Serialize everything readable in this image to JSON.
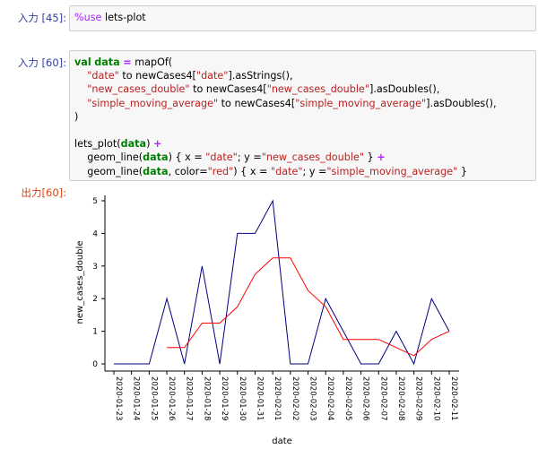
{
  "cells": [
    {
      "prompt": "入力 [45]:",
      "code": [
        [
          {
            "t": "%use",
            "c": "magic"
          },
          {
            "t": " lets-plot",
            "c": ""
          }
        ]
      ]
    },
    {
      "prompt": "入力 [60]:",
      "code": [
        [
          {
            "t": "val",
            "c": "kw"
          },
          {
            "t": " ",
            "c": ""
          },
          {
            "t": "data",
            "c": "kw"
          },
          {
            "t": " ",
            "c": ""
          },
          {
            "t": "=",
            "c": "op"
          },
          {
            "t": " mapOf(",
            "c": ""
          }
        ],
        [
          {
            "t": "    ",
            "c": ""
          },
          {
            "t": "\"date\"",
            "c": "str"
          },
          {
            "t": " to newCases4[",
            "c": ""
          },
          {
            "t": "\"date\"",
            "c": "str"
          },
          {
            "t": "].asStrings(),",
            "c": ""
          }
        ],
        [
          {
            "t": "    ",
            "c": ""
          },
          {
            "t": "\"new_cases_double\"",
            "c": "str"
          },
          {
            "t": " to newCases4[",
            "c": ""
          },
          {
            "t": "\"new_cases_double\"",
            "c": "str"
          },
          {
            "t": "].asDoubles(),",
            "c": ""
          }
        ],
        [
          {
            "t": "    ",
            "c": ""
          },
          {
            "t": "\"simple_moving_average\"",
            "c": "str"
          },
          {
            "t": " to newCases4[",
            "c": ""
          },
          {
            "t": "\"simple_moving_average\"",
            "c": "str"
          },
          {
            "t": "].asDoubles(),",
            "c": ""
          }
        ],
        [
          {
            "t": ")",
            "c": ""
          }
        ],
        [
          {
            "t": "",
            "c": ""
          }
        ],
        [
          {
            "t": "lets_plot(",
            "c": ""
          },
          {
            "t": "data",
            "c": "kw"
          },
          {
            "t": ") ",
            "c": ""
          },
          {
            "t": "+",
            "c": "op"
          }
        ],
        [
          {
            "t": "    geom_line(",
            "c": ""
          },
          {
            "t": "data",
            "c": "kw"
          },
          {
            "t": ") { x = ",
            "c": ""
          },
          {
            "t": "\"date\"",
            "c": "str"
          },
          {
            "t": "; y =",
            "c": ""
          },
          {
            "t": "\"new_cases_double\"",
            "c": "str"
          },
          {
            "t": " } ",
            "c": ""
          },
          {
            "t": "+",
            "c": "op"
          }
        ],
        [
          {
            "t": "    geom_line(",
            "c": ""
          },
          {
            "t": "data",
            "c": "kw"
          },
          {
            "t": ", color=",
            "c": ""
          },
          {
            "t": "\"red\"",
            "c": "str"
          },
          {
            "t": ") { x = ",
            "c": ""
          },
          {
            "t": "\"date\"",
            "c": "str"
          },
          {
            "t": "; y =",
            "c": ""
          },
          {
            "t": "\"simple_moving_average\"",
            "c": "str"
          },
          {
            "t": " }",
            "c": ""
          }
        ]
      ]
    }
  ],
  "output": {
    "prompt": "出力[60]:"
  },
  "chart_data": {
    "type": "line",
    "xlabel": "date",
    "ylabel": "new_cases_double",
    "ylim": [
      0,
      5
    ],
    "yticks": [
      0,
      1,
      2,
      3,
      4,
      5
    ],
    "categories": [
      "2020-01-23",
      "2020-01-24",
      "2020-01-25",
      "2020-01-26",
      "2020-01-27",
      "2020-01-28",
      "2020-01-29",
      "2020-01-30",
      "2020-01-31",
      "2020-02-01",
      "2020-02-02",
      "2020-02-03",
      "2020-02-04",
      "2020-02-05",
      "2020-02-06",
      "2020-02-07",
      "2020-02-08",
      "2020-02-09",
      "2020-02-10",
      "2020-02-11"
    ],
    "xtick_labels": [
      "2020-01-23",
      "2020-01-24",
      "2020-01-25",
      "2020-01-26",
      "2020-01-27",
      "2020-01-28",
      "2020-01-29",
      "2020-01-30",
      "2020-01-31",
      "2020-02-01",
      "2020-02-02",
      "2020-02-03",
      "2020-02-04",
      "2020-02-05",
      "2020-02-06",
      "2020-02-07",
      "2020-02-08",
      "2020-02-09",
      "2020-02-10",
      "2020-02-11"
    ],
    "grid": false,
    "series": [
      {
        "color": "#000080",
        "values": [
          0,
          0,
          0,
          2,
          0,
          3,
          0,
          4,
          4,
          5,
          0,
          0,
          2,
          1,
          0,
          0,
          1,
          0,
          2,
          1
        ]
      },
      {
        "color": "#ff0000",
        "values": [
          null,
          null,
          null,
          0.5,
          0.5,
          1.25,
          1.25,
          1.75,
          2.75,
          3.25,
          3.25,
          2.25,
          1.75,
          0.75,
          0.75,
          0.75,
          0.5,
          0.25,
          0.75,
          1.0
        ]
      }
    ]
  }
}
